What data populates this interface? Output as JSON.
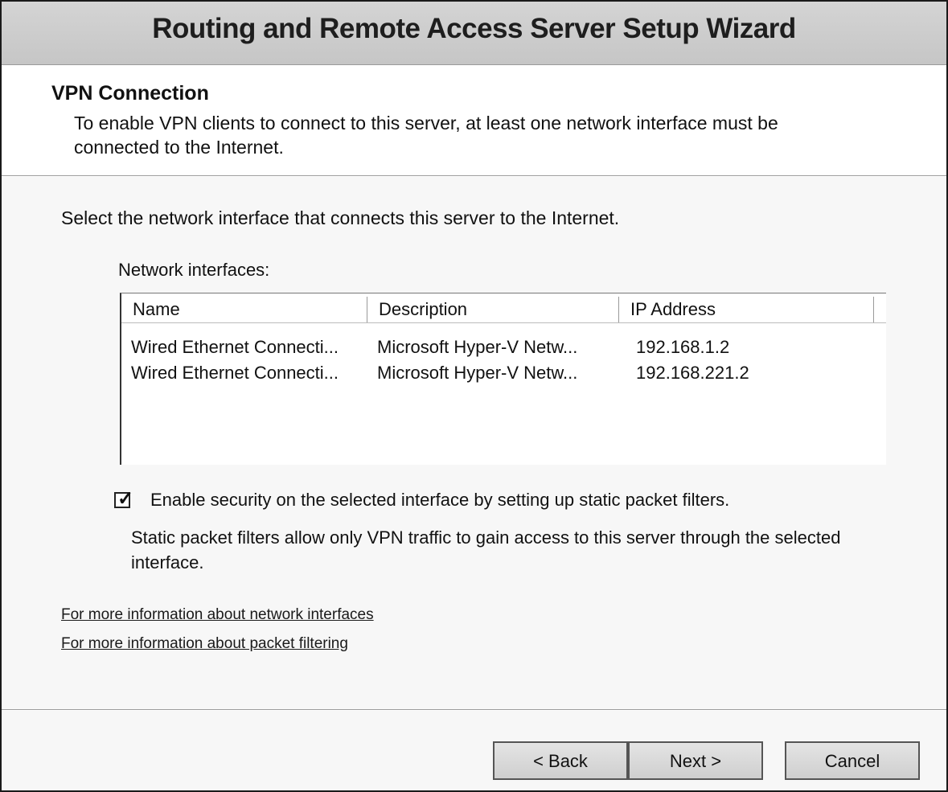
{
  "window": {
    "title": "Routing and Remote Access Server Setup Wizard"
  },
  "header": {
    "title": "VPN Connection",
    "description": "To enable VPN clients to connect to this server, at least one network interface must be connected to the Internet."
  },
  "body": {
    "instruction": "Select the network interface that connects this server to the Internet.",
    "list_label": "Network interfaces:",
    "columns": [
      "Name",
      "Description",
      "IP Address"
    ],
    "rows": [
      {
        "name": "Wired Ethernet Connecti...",
        "description": "Microsoft Hyper-V Netw...",
        "ip": "192.168.1.2"
      },
      {
        "name": "Wired Ethernet Connecti...",
        "description": "Microsoft Hyper-V Netw...",
        "ip": "192.168.221.2"
      }
    ],
    "checkbox": {
      "checked": true,
      "label": "Enable security on the selected interface by setting up static packet filters.",
      "note": "Static packet filters allow only VPN traffic to gain access to this server through the selected interface."
    },
    "links": [
      "For more information about network interfaces",
      "For more information about packet filtering"
    ]
  },
  "footer": {
    "back_label": "< Back",
    "next_label": "Next >",
    "cancel_label": "Cancel"
  }
}
